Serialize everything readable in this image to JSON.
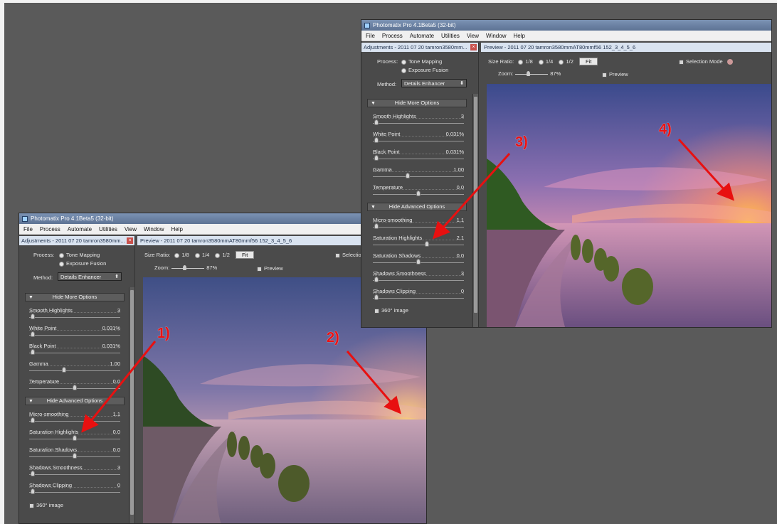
{
  "app": {
    "title": "Photomatix Pro 4.1Beta5 (32-bit)",
    "menu": [
      "File",
      "Process",
      "Automate",
      "Utilities",
      "View",
      "Window",
      "Help"
    ]
  },
  "adjustments": {
    "header": "Adjustments - 2011 07 20 tamron3580mm...",
    "process_label": "Process:",
    "process_options": [
      "Tone Mapping",
      "Exposure Fusion"
    ],
    "method_label": "Method:",
    "method_value": "Details Enhancer",
    "more_options_header": "Hide More Options",
    "advanced_options_header": "Hide Advanced Options",
    "image_360": "360° image"
  },
  "preview": {
    "header": "Preview - 2011 07 20 tamron3580mmAT80mmf56 152_3_4_5_6",
    "size_ratio_label": "Size Ratio:",
    "ratios": [
      "1/8",
      "1/4",
      "1/2"
    ],
    "fit_label": "Fit",
    "zoom_label": "Zoom:",
    "zoom_value": "87%",
    "preview_label": "Preview",
    "selection_mode": "Selection Mode",
    "selection_mode_cut": "Selectio"
  },
  "window_a": {
    "more_sliders": [
      {
        "name": "Smooth Highlights",
        "value": "3",
        "pos": 0.02
      },
      {
        "name": "White Point",
        "value": "0.031%",
        "pos": 0.02
      },
      {
        "name": "Black Point",
        "value": "0.031%",
        "pos": 0.02
      },
      {
        "name": "Gamma",
        "value": "1.00",
        "pos": 0.38
      },
      {
        "name": "Temperature",
        "value": "0.0",
        "pos": 0.5
      }
    ],
    "advanced_sliders": [
      {
        "name": "Micro-smoothing",
        "value": "1.1",
        "pos": 0.02
      },
      {
        "name": "Saturation Highlights",
        "value": "0.0",
        "pos": 0.5
      },
      {
        "name": "Saturation Shadows",
        "value": "0.0",
        "pos": 0.5
      },
      {
        "name": "Shadows Smoothness",
        "value": "3",
        "pos": 0.02
      },
      {
        "name": "Shadows Clipping",
        "value": "0",
        "pos": 0.02
      }
    ]
  },
  "window_b": {
    "more_sliders": [
      {
        "name": "Smooth Highlights",
        "value": "3",
        "pos": 0.02
      },
      {
        "name": "White Point",
        "value": "0.031%",
        "pos": 0.02
      },
      {
        "name": "Black Point",
        "value": "0.031%",
        "pos": 0.02
      },
      {
        "name": "Gamma",
        "value": "1.00",
        "pos": 0.38
      },
      {
        "name": "Temperature",
        "value": "0.0",
        "pos": 0.5
      }
    ],
    "advanced_sliders": [
      {
        "name": "Micro-smoothing",
        "value": "1.1",
        "pos": 0.02
      },
      {
        "name": "Saturation Highlights",
        "value": "2.1",
        "pos": 0.6
      },
      {
        "name": "Saturation Shadows",
        "value": "0.0",
        "pos": 0.5
      },
      {
        "name": "Shadows Smoothness",
        "value": "3",
        "pos": 0.02
      },
      {
        "name": "Shadows Clipping",
        "value": "0",
        "pos": 0.02
      }
    ]
  },
  "callouts": [
    "1)",
    "2)",
    "3)",
    "4)"
  ],
  "colors": {
    "arrow": "#e81010",
    "panel": "#4b4b4b",
    "header": "#d9e3f0"
  }
}
